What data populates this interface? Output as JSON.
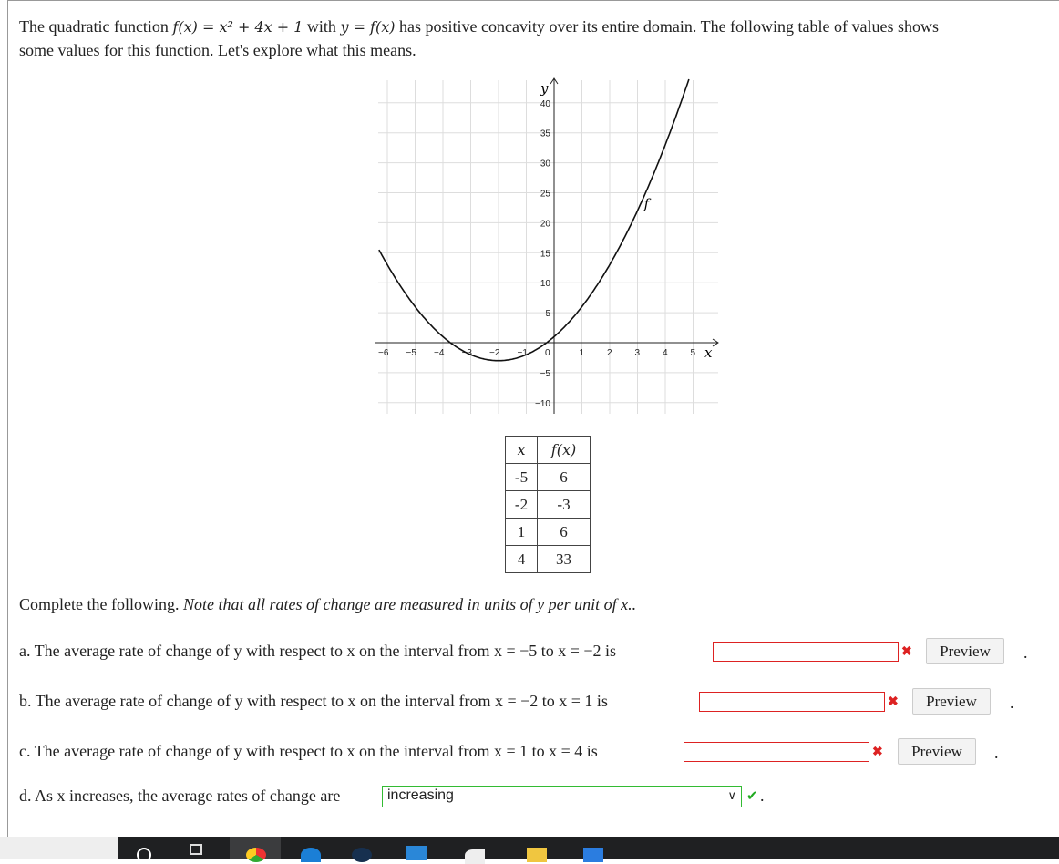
{
  "intro": {
    "line1_pre": "The quadratic function ",
    "fx": "f(x) = x² + 4x + 1",
    "mid": " with ",
    "yfx": "y = f(x)",
    "line1_post": " has positive concavity over its entire domain. The following table of values shows",
    "line2": "some values for this function. Let's explore what this means."
  },
  "chart_data": {
    "type": "line",
    "function": "x^2+4x+1",
    "curve_label": "f",
    "xlabel": "x",
    "ylabel": "y",
    "xlim": [
      -6.3,
      6.0
    ],
    "ylim": [
      -11.5,
      44
    ],
    "x_ticks": [
      -6,
      -5,
      -4,
      -3,
      -2,
      -1,
      0,
      1,
      2,
      3,
      4,
      5
    ],
    "y_ticks": [
      -10,
      -5,
      5,
      10,
      15,
      20,
      25,
      30,
      35,
      40
    ],
    "grid": true
  },
  "table": {
    "headers": [
      "x",
      "f(x)"
    ],
    "rows": [
      [
        "-5",
        "6"
      ],
      [
        "-2",
        "-3"
      ],
      [
        "1",
        "6"
      ],
      [
        "4",
        "33"
      ]
    ]
  },
  "instructions": {
    "pre": "Complete the following. ",
    "note": "Note that all rates of change are measured in units of y per unit of x.."
  },
  "questions": [
    {
      "text": "a. The average rate of change of y with respect to x on the interval from x = −5 to x = −2 is",
      "value": "",
      "preview": "Preview",
      "status": "✖",
      "end": "."
    },
    {
      "text": "b. The average rate of change of y with respect to x on the interval from x = −2 to x = 1 is",
      "value": "",
      "preview": "Preview",
      "status": "✖",
      "end": "."
    },
    {
      "text": "c. The average rate of change of y with respect to x on the interval from x = 1 to x = 4 is",
      "value": "",
      "preview": "Preview",
      "status": "✖",
      "end": "."
    }
  ],
  "d": {
    "text": "d. As x increases, the average rates of change are",
    "selected": "increasing",
    "status": "✔",
    "end": "."
  },
  "taskbar": {
    "icons": [
      "search-icon",
      "task-view-icon",
      "chrome-icon",
      "edge-icon",
      "app-icon",
      "mail-icon",
      "app2-icon",
      "folder-icon",
      "word-icon"
    ]
  }
}
